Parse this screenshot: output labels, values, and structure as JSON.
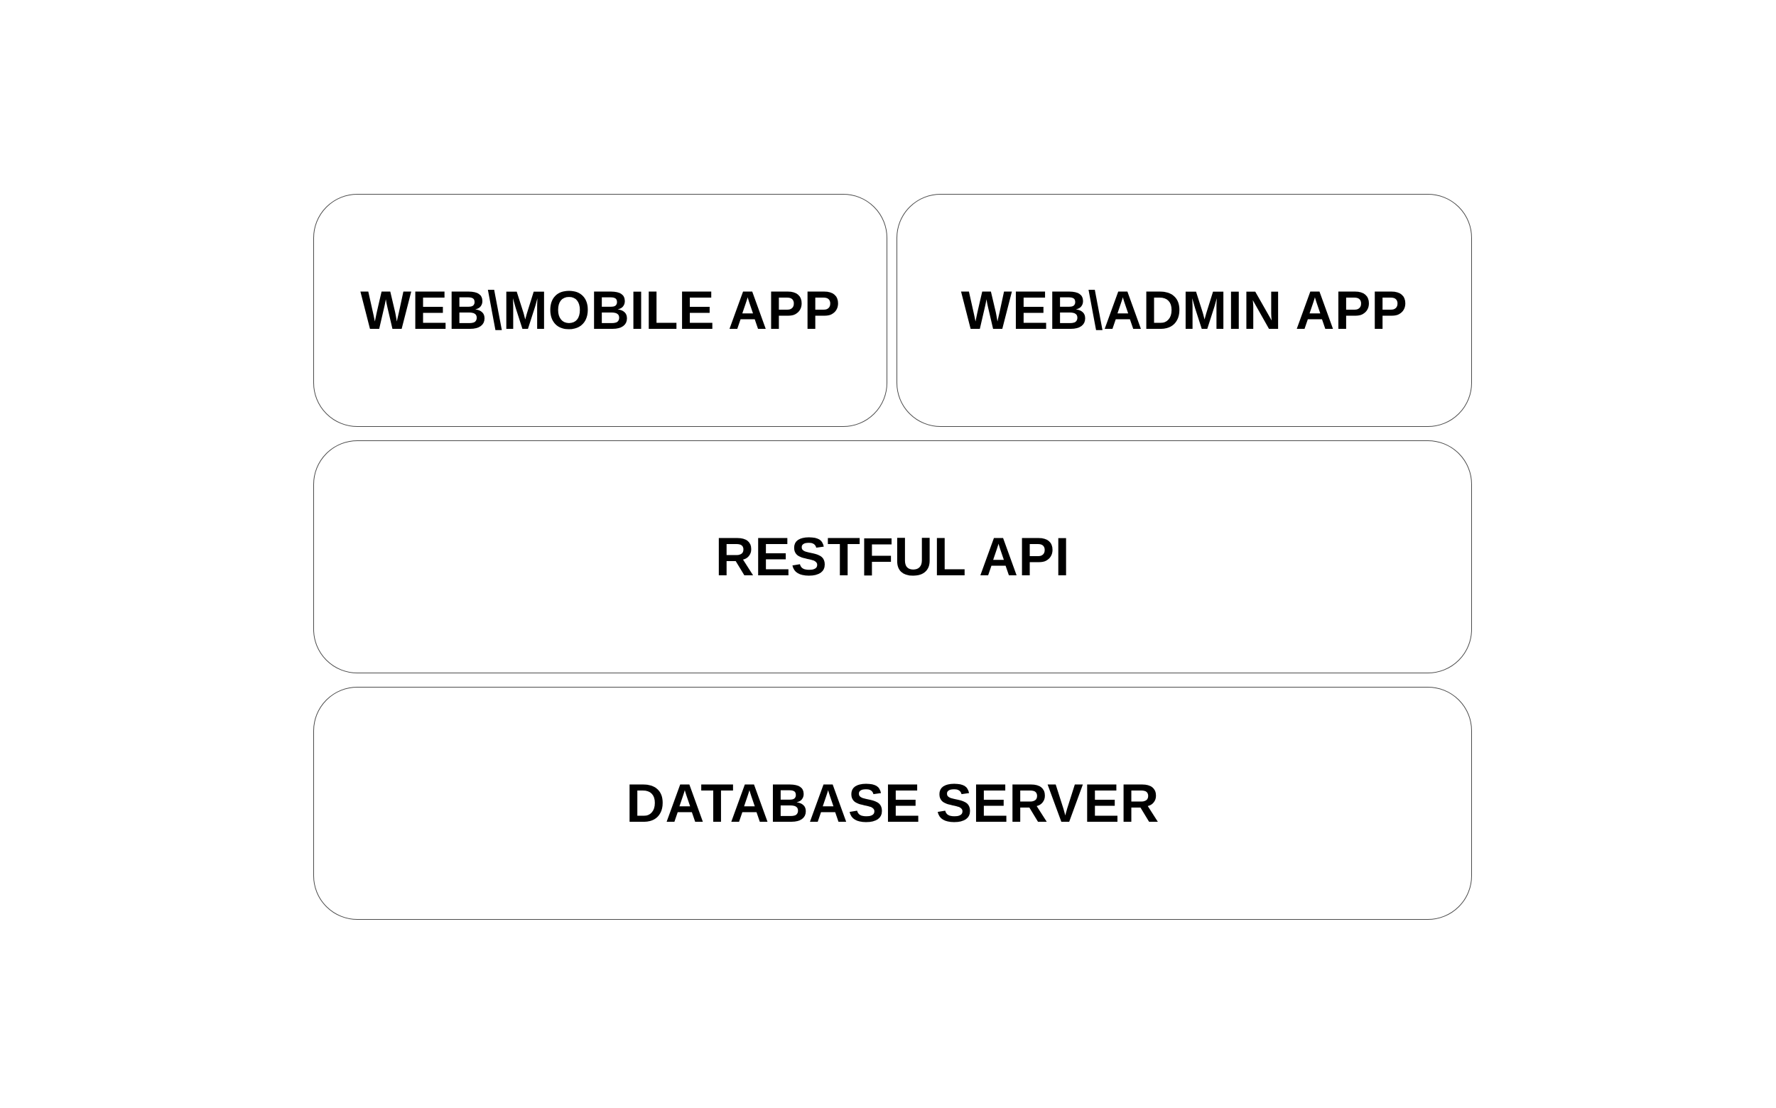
{
  "layers": {
    "client_mobile": "WEB\\MOBILE APP",
    "client_admin": "WEB\\ADMIN APP",
    "api": "RESTFUL API",
    "database": "DATABASE SERVER"
  },
  "colors": {
    "border": "#4a4a4a",
    "text": "#000000",
    "background": "#ffffff"
  }
}
